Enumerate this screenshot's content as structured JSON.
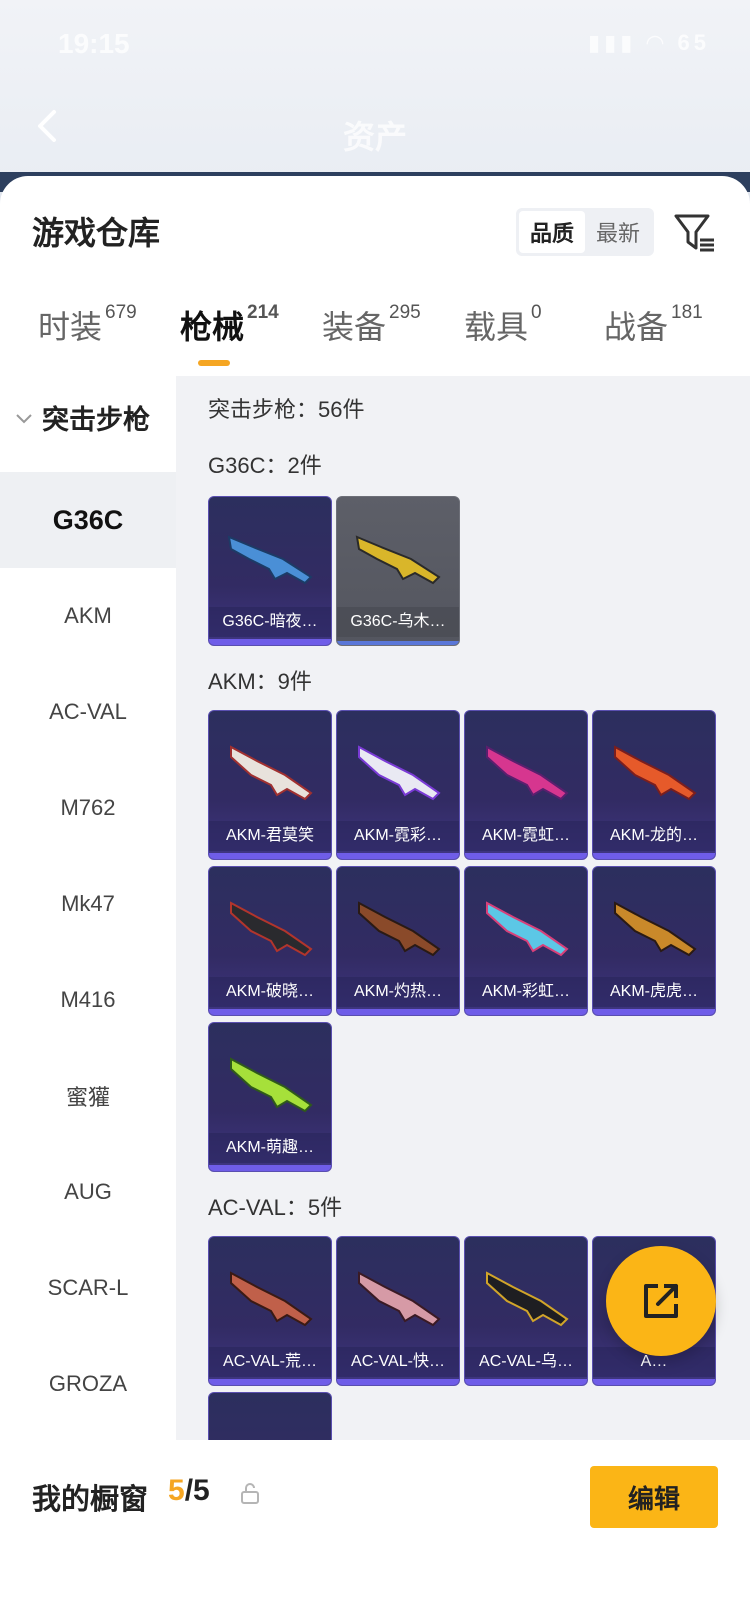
{
  "status": {
    "time": "19:15",
    "battery": "65"
  },
  "nav": {
    "title": "资产"
  },
  "header": {
    "title": "游戏仓库",
    "sort_quality": "品质",
    "sort_latest": "最新"
  },
  "tabs": [
    {
      "label": "时装",
      "count": "679"
    },
    {
      "label": "枪械",
      "count": "214"
    },
    {
      "label": "装备",
      "count": "295"
    },
    {
      "label": "载具",
      "count": "0"
    },
    {
      "label": "战备",
      "count": "181"
    }
  ],
  "sidebar": {
    "group": "突击步枪",
    "items": [
      "G36C",
      "AKM",
      "AC-VAL",
      "M762",
      "Mk47",
      "M416",
      "蜜獾",
      "AUG",
      "SCAR-L",
      "GROZA"
    ]
  },
  "content": {
    "summary": "突击步枪：56件",
    "sections": [
      {
        "title": "G36C：2件",
        "cards": [
          "G36C-暗夜…",
          "G36C-乌木…"
        ]
      },
      {
        "title": "AKM：9件",
        "cards": [
          "AKM-君莫笑",
          "AKM-霓彩…",
          "AKM-霓虹…",
          "AKM-龙的…",
          "AKM-破晓…",
          "AKM-灼热…",
          "AKM-彩虹…",
          "AKM-虎虎…",
          "AKM-萌趣…"
        ]
      },
      {
        "title": "AC-VAL：5件",
        "cards": [
          "AC-VAL-荒…",
          "AC-VAL-快…",
          "AC-VAL-乌…",
          "A…"
        ]
      }
    ]
  },
  "showcase": {
    "title": "我的橱窗",
    "current": "5",
    "total": "/5",
    "edit": "编辑"
  },
  "colors": {
    "accent": "#fbb516",
    "card_bg": "#2c2f5e",
    "card_border": "#5a4fb0"
  }
}
